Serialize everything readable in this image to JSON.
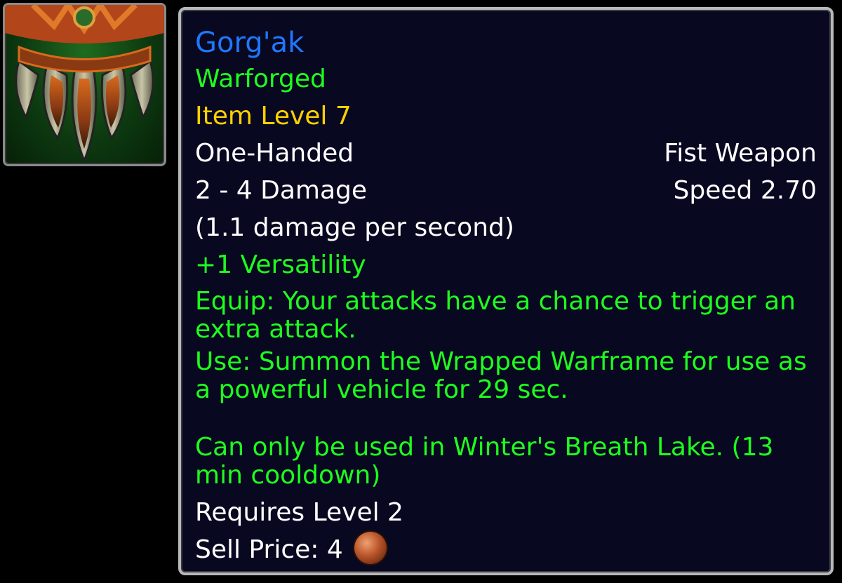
{
  "item": {
    "icon": "fist-weapon-icon",
    "name": "Gorg'ak",
    "quality_color": "#1e78ff",
    "tag": "Warforged",
    "item_level": "Item Level 7",
    "slot": "One-Handed",
    "type": "Fist Weapon",
    "damage": "2 - 4 Damage",
    "speed": "Speed 2.70",
    "dps": "(1.1 damage per second)",
    "stat": "+1 Versatility",
    "equip": "Equip: Your attacks have a chance to trigger an extra attack.",
    "use": "Use: Summon the Wrapped Warframe for use as a powerful vehicle for 29 sec.",
    "use_note": "Can only be used in Winter's Breath Lake. (13 min cooldown)",
    "requires": "Requires Level 2",
    "sell_label": "Sell Price:",
    "sell_amount": "4",
    "sell_currency_icon": "copper-coin-icon"
  },
  "colors": {
    "name": "#1e78ff",
    "green": "#1eff1e",
    "gold": "#ffd100",
    "white": "#ffffff",
    "background": "#080820"
  }
}
